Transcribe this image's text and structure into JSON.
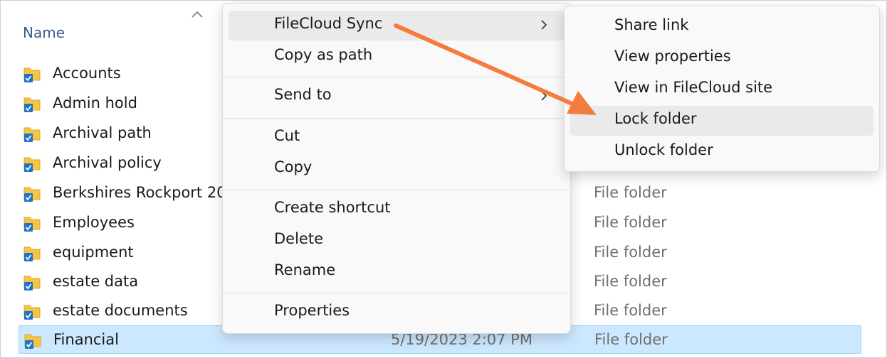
{
  "explorer": {
    "column_header": "Name",
    "rows": [
      {
        "name": "Accounts",
        "date": "",
        "type": ""
      },
      {
        "name": "Admin hold",
        "date": "",
        "type": ""
      },
      {
        "name": "Archival path",
        "date": "",
        "type": ""
      },
      {
        "name": "Archival policy",
        "date": "",
        "type": ""
      },
      {
        "name": "Berkshires Rockport 20",
        "date": "",
        "type": "File folder"
      },
      {
        "name": "Employees",
        "date": "",
        "type": "File folder"
      },
      {
        "name": "equipment",
        "date": "",
        "type": "File folder"
      },
      {
        "name": "estate data",
        "date": "",
        "type": "File folder"
      },
      {
        "name": "estate documents",
        "date": "",
        "type": "File folder"
      },
      {
        "name": "Financial",
        "date": "5/19/2023 2:07 PM",
        "type": "File folder",
        "selected": true
      }
    ]
  },
  "context_menu": {
    "filecloud_sync": "FileCloud Sync",
    "copy_as_path": "Copy as path",
    "send_to": "Send to",
    "cut": "Cut",
    "copy": "Copy",
    "create_shortcut": "Create shortcut",
    "delete": "Delete",
    "rename": "Rename",
    "properties": "Properties"
  },
  "submenu": {
    "share_link": "Share link",
    "view_properties": "View properties",
    "view_in_site": "View in FileCloud site",
    "lock_folder": "Lock folder",
    "unlock_folder": "Unlock folder"
  },
  "colors": {
    "folder": "#f6c544",
    "folder_dark": "#dca52b",
    "check_badge": "#1e73c8",
    "selection": "#cce8ff",
    "annotation_arrow": "#f47c3c"
  }
}
